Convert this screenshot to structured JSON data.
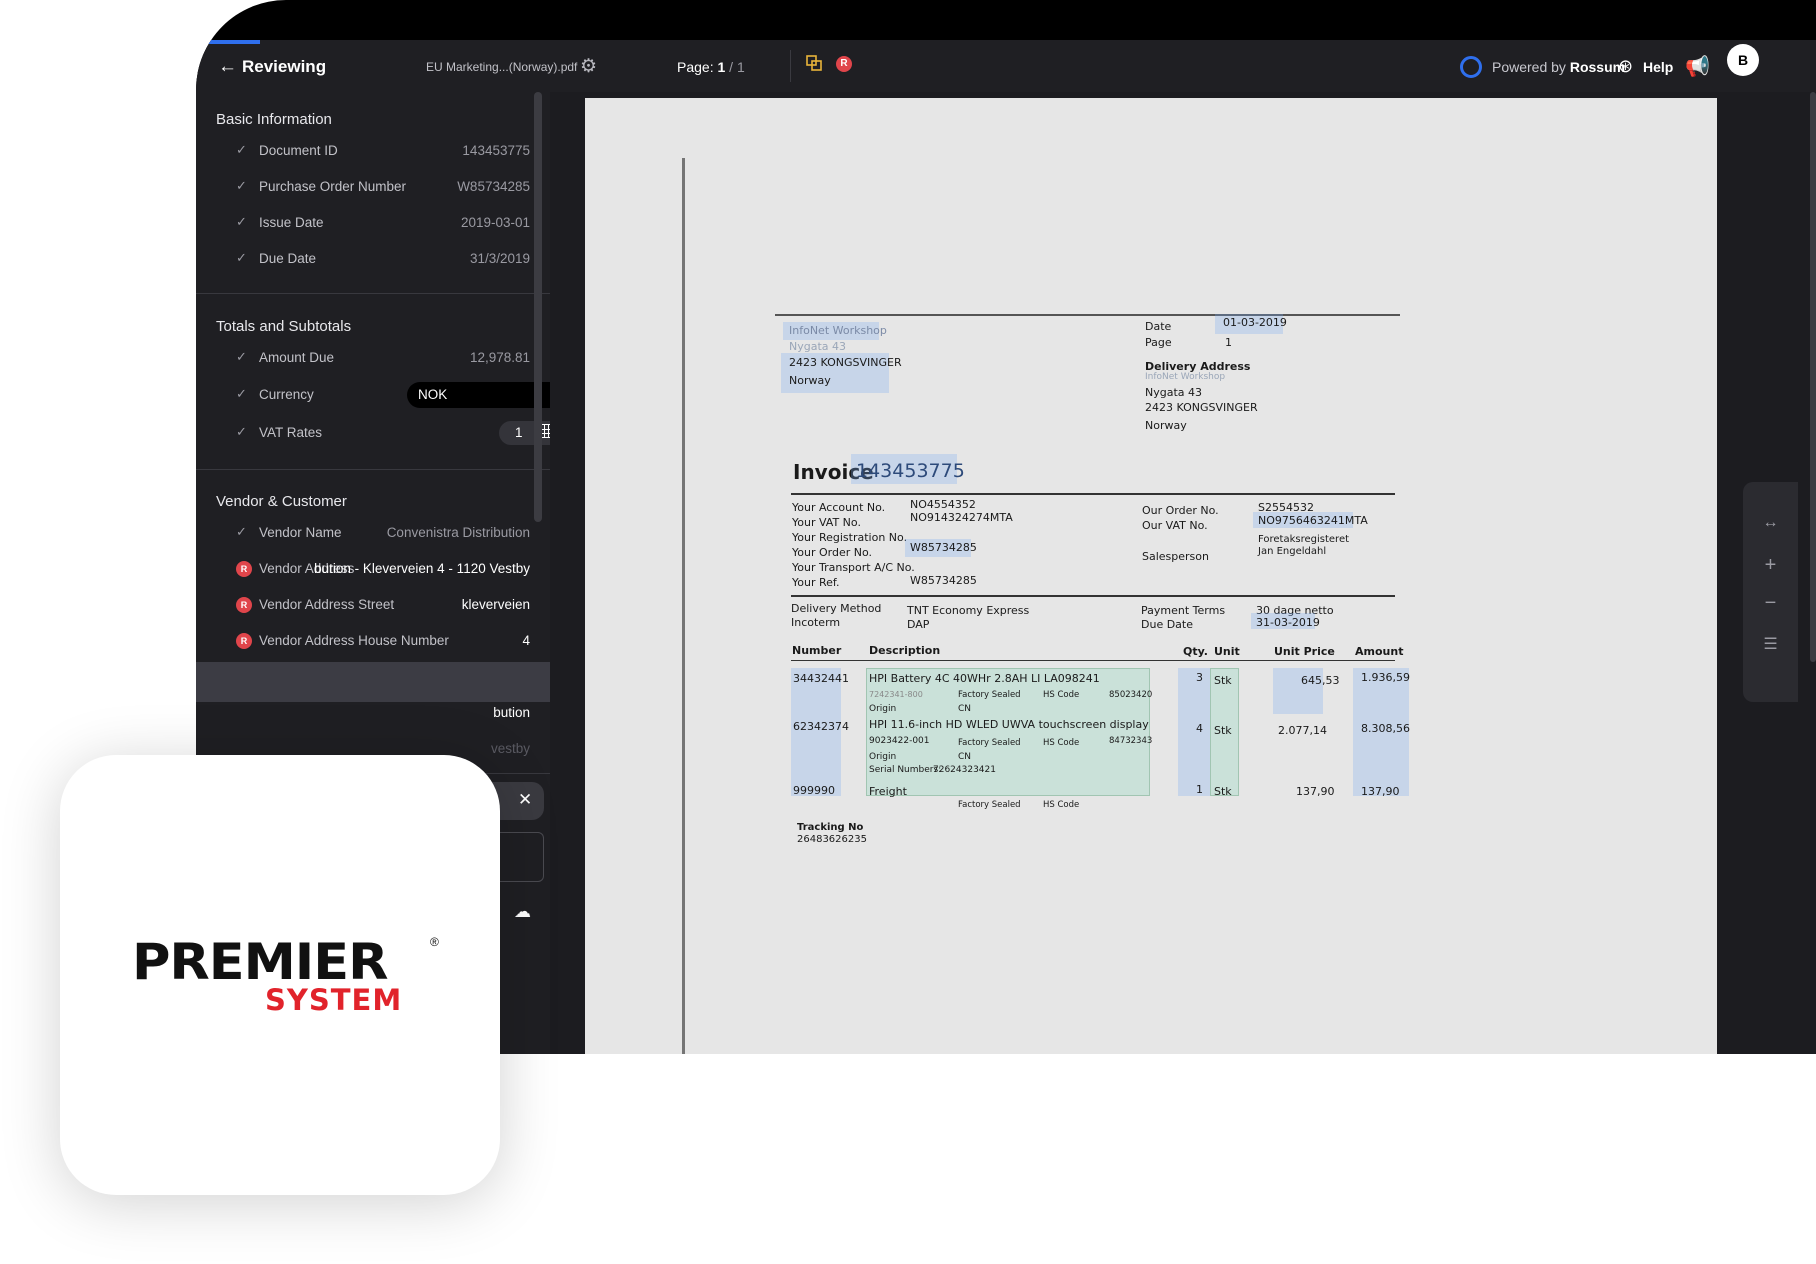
{
  "header": {
    "title": "Reviewing",
    "filename": "EU Marketing...(Norway).pdf",
    "page_label": "Page:",
    "page_current": "1",
    "page_sep": "/",
    "page_total": "1",
    "powered_by": "Powered by",
    "powered_brand": "Rossum",
    "help_label": "Help",
    "avatar_initial": "B"
  },
  "sections": {
    "basic": {
      "title": "Basic Information",
      "fields": [
        {
          "label": "Document ID",
          "value": "143453775"
        },
        {
          "label": "Purchase Order Number",
          "value": "W85734285"
        },
        {
          "label": "Issue Date",
          "value": "2019-03-01"
        },
        {
          "label": "Due Date",
          "value": "31/3/2019"
        }
      ]
    },
    "totals": {
      "title": "Totals and Subtotals",
      "fields": [
        {
          "label": "Amount Due",
          "value": "12,978.81"
        },
        {
          "label": "Currency",
          "value": "NOK"
        },
        {
          "label": "VAT Rates",
          "value": "1"
        }
      ]
    },
    "vendor": {
      "title": "Vendor & Customer",
      "fields": [
        {
          "label": "Vendor Name",
          "value": "Convenistra Distribution"
        },
        {
          "label": "Vendor Address",
          "value": "bution - Kleverveien 4 - 1120 Vestby"
        },
        {
          "label": "Vendor Address Street",
          "value": "kleverveien"
        },
        {
          "label": "Vendor Address House Number",
          "value": "4"
        },
        {
          "label": "",
          "value": "bution"
        },
        {
          "label": "",
          "value": "vestby"
        }
      ]
    }
  },
  "document": {
    "sender_name": "InfoNet Workshop",
    "sender_street": "Nygata 43",
    "sender_city": "2423 KONGSVINGER",
    "sender_country": "Norway",
    "date_label": "Date",
    "date_value": "01-03-2019",
    "page_label": "Page",
    "page_value": "1",
    "delivery_title": "Delivery Address",
    "delivery_name": "InfoNet Workshop",
    "delivery_street": "Nygata 43",
    "delivery_city": "2423 KONGSVINGER",
    "delivery_country": "Norway",
    "invoice_word": "Invoice",
    "invoice_number": "143453775",
    "left_labels": [
      "Your Account No.",
      "Your VAT No.",
      "Your Registration No.",
      "Your Order No.",
      "Your Transport A/C No.",
      "Your Ref."
    ],
    "left_values": [
      "NO4554352",
      "NO914324274MTA",
      "",
      "W85734285",
      "",
      "W85734285"
    ],
    "right_labels": [
      "Our Order No.",
      "Our VAT No.",
      "",
      "Salesperson"
    ],
    "right_values": [
      "S2554532",
      "NO9756463241MTA",
      "Foretaksregisteret",
      "Jan Engeldahl"
    ],
    "delivery_method_label": "Delivery Method",
    "delivery_method_value": "TNT Economy Express",
    "incoterm_label": "Incoterm",
    "incoterm_value": "DAP",
    "payment_terms_label": "Payment Terms",
    "payment_terms_value": "30 dage netto",
    "due_date_label": "Due Date",
    "due_date_value": "31-03-2019",
    "col_headers": [
      "Number",
      "Description",
      "Qty.",
      "Unit",
      "Unit Price",
      "Amount"
    ],
    "items": [
      {
        "number": "34432441",
        "desc": "HPI Battery 4C 40WHr 2.8AH LI LA098241",
        "code": "7242341-800",
        "origin": "CN",
        "hs": "85023420",
        "qty": "3",
        "unit": "Stk",
        "price": "645,53",
        "amount": "1.936,59"
      },
      {
        "number": "62342374",
        "desc": "HPI 11.6-inch HD WLED UWVA touchscreen display",
        "code": "9023422-001",
        "origin": "CN",
        "hs": "84732343",
        "serial": "72624323421",
        "qty": "4",
        "unit": "Stk",
        "price": "2.077,14",
        "amount": "8.308,56"
      },
      {
        "number": "999990",
        "desc": "Freight",
        "qty": "1",
        "unit": "Stk",
        "price": "137,90",
        "amount": "137,90"
      }
    ],
    "factory_sealed": "Factory Sealed",
    "hs_code": "HS Code",
    "origin_label": "Origin",
    "serial_label": "Serial Numbers:",
    "tracking_label": "Tracking No",
    "tracking_value": "26483626235"
  },
  "logo": {
    "line1": "PREMIER",
    "line2": "SYSTEM",
    "reg": "®",
    "brand_red": "#e1232b"
  },
  "colors": {
    "accent": "#2f6fed",
    "error_badge": "#e0454b",
    "sidebar_bg": "#1f1f23"
  }
}
